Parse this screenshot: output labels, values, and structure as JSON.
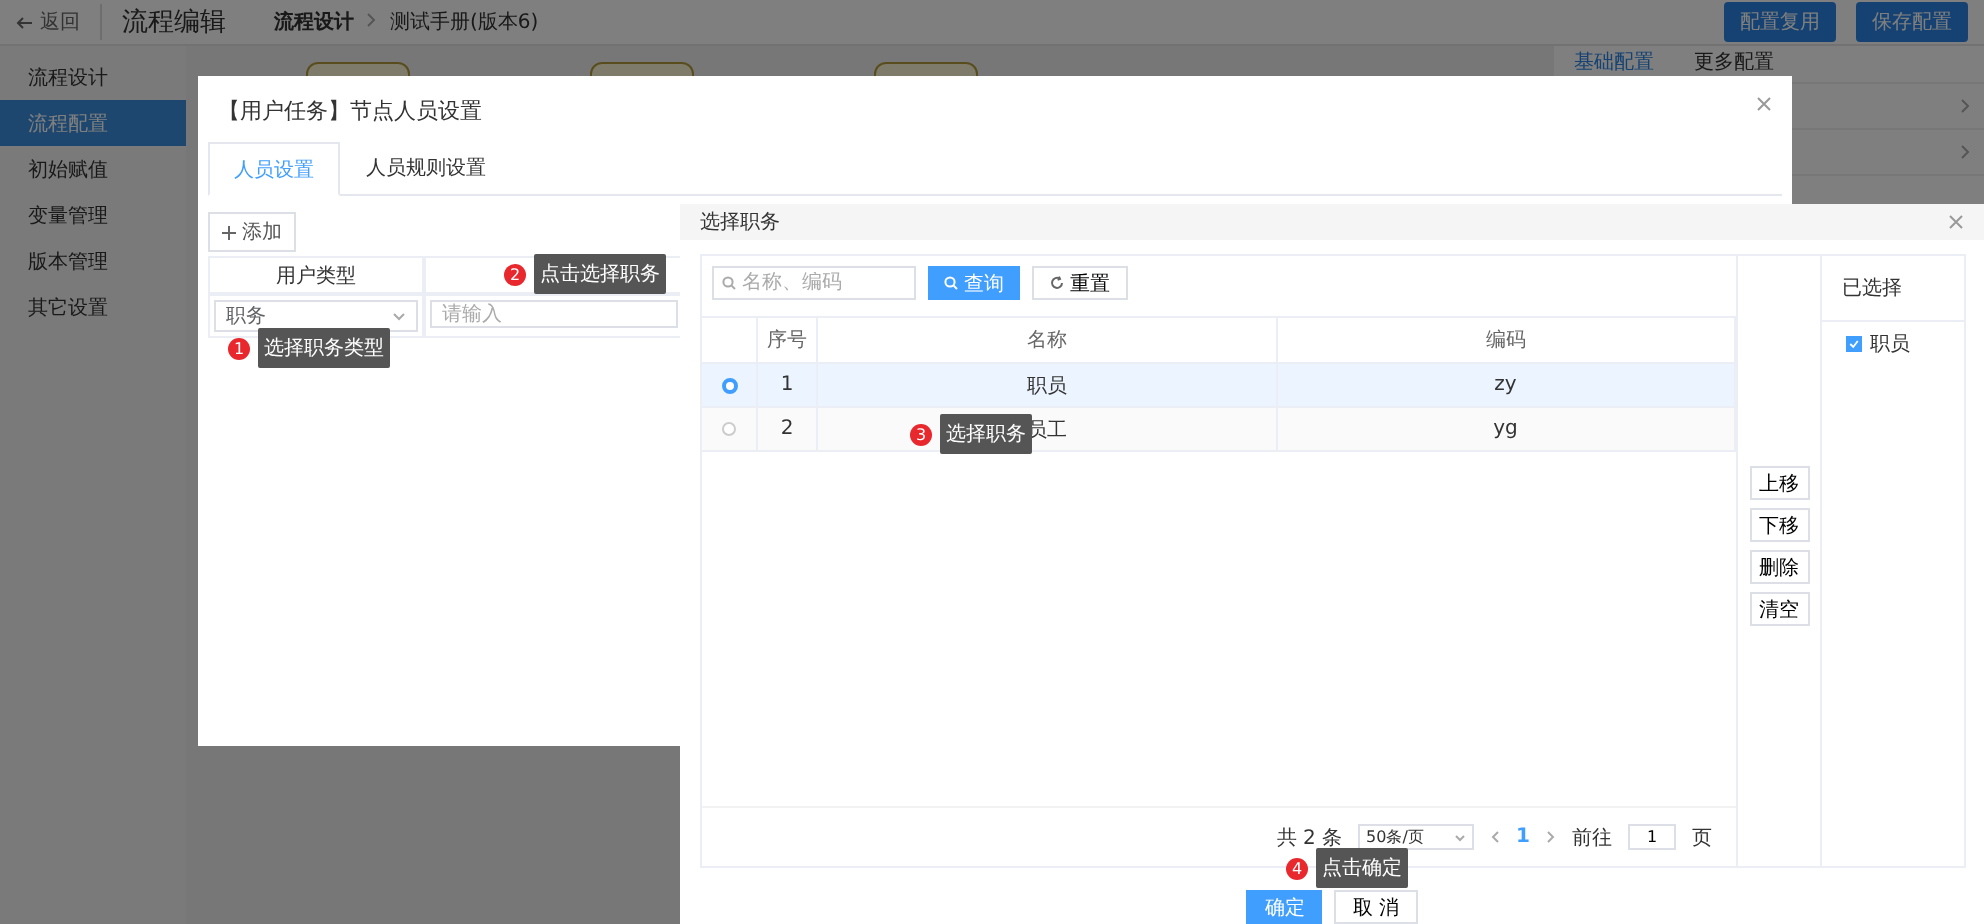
{
  "header": {
    "back": "返回",
    "title": "流程编辑",
    "breadcrumb": [
      "流程设计",
      "测试手册(版本6)"
    ],
    "actions": [
      "配置复用",
      "保存配置"
    ]
  },
  "sidebar": {
    "items": [
      {
        "label": "流程设计",
        "selected": false
      },
      {
        "label": "流程配置",
        "selected": true
      },
      {
        "label": "初始赋值",
        "selected": false
      },
      {
        "label": "变量管理",
        "selected": false
      },
      {
        "label": "版本管理",
        "selected": false
      },
      {
        "label": "其它设置",
        "selected": false
      }
    ]
  },
  "right_panel": {
    "tabs": [
      {
        "label": "基础配置",
        "selected": true
      },
      {
        "label": "更多配置",
        "selected": false
      }
    ]
  },
  "node_dialog": {
    "title": "【用户任务】节点人员设置",
    "tabs": [
      {
        "label": "人员设置",
        "selected": true
      },
      {
        "label": "人员规则设置",
        "selected": false
      }
    ],
    "add_button": "添加",
    "table": {
      "columns": [
        "用户类型"
      ],
      "rows": [
        {
          "user_type": "职务",
          "placeholder": "请输入"
        }
      ]
    }
  },
  "select_dialog": {
    "title": "选择职务",
    "search": {
      "placeholder": "名称、编码"
    },
    "search_button": "查询",
    "reset_button": "重置",
    "table": {
      "columns": [
        "序号",
        "名称",
        "编码"
      ],
      "rows": [
        {
          "selected": true,
          "index": "1",
          "name": "职员",
          "code": "zy"
        },
        {
          "selected": false,
          "index": "2",
          "name": "员工",
          "code": "yg"
        }
      ]
    },
    "pagination": {
      "total": "共 2 条",
      "page_size": "50条/页",
      "current_page": "1",
      "goto_label": "前往",
      "goto_value": "1",
      "page_suffix": "页"
    },
    "order_buttons": [
      "上移",
      "下移",
      "删除",
      "清空"
    ],
    "selected_panel": {
      "title": "已选择",
      "items": [
        {
          "label": "职员",
          "checked": true
        }
      ]
    },
    "buttons": [
      {
        "label": "确定",
        "kind": "primary"
      },
      {
        "label": "取 消",
        "kind": "default"
      }
    ]
  },
  "callouts": [
    {
      "number": "1",
      "text": "选择职务类型"
    },
    {
      "number": "2",
      "text": "点击选择职务"
    },
    {
      "number": "3",
      "text": "选择职务"
    },
    {
      "number": "4",
      "text": "点击确定"
    }
  ]
}
